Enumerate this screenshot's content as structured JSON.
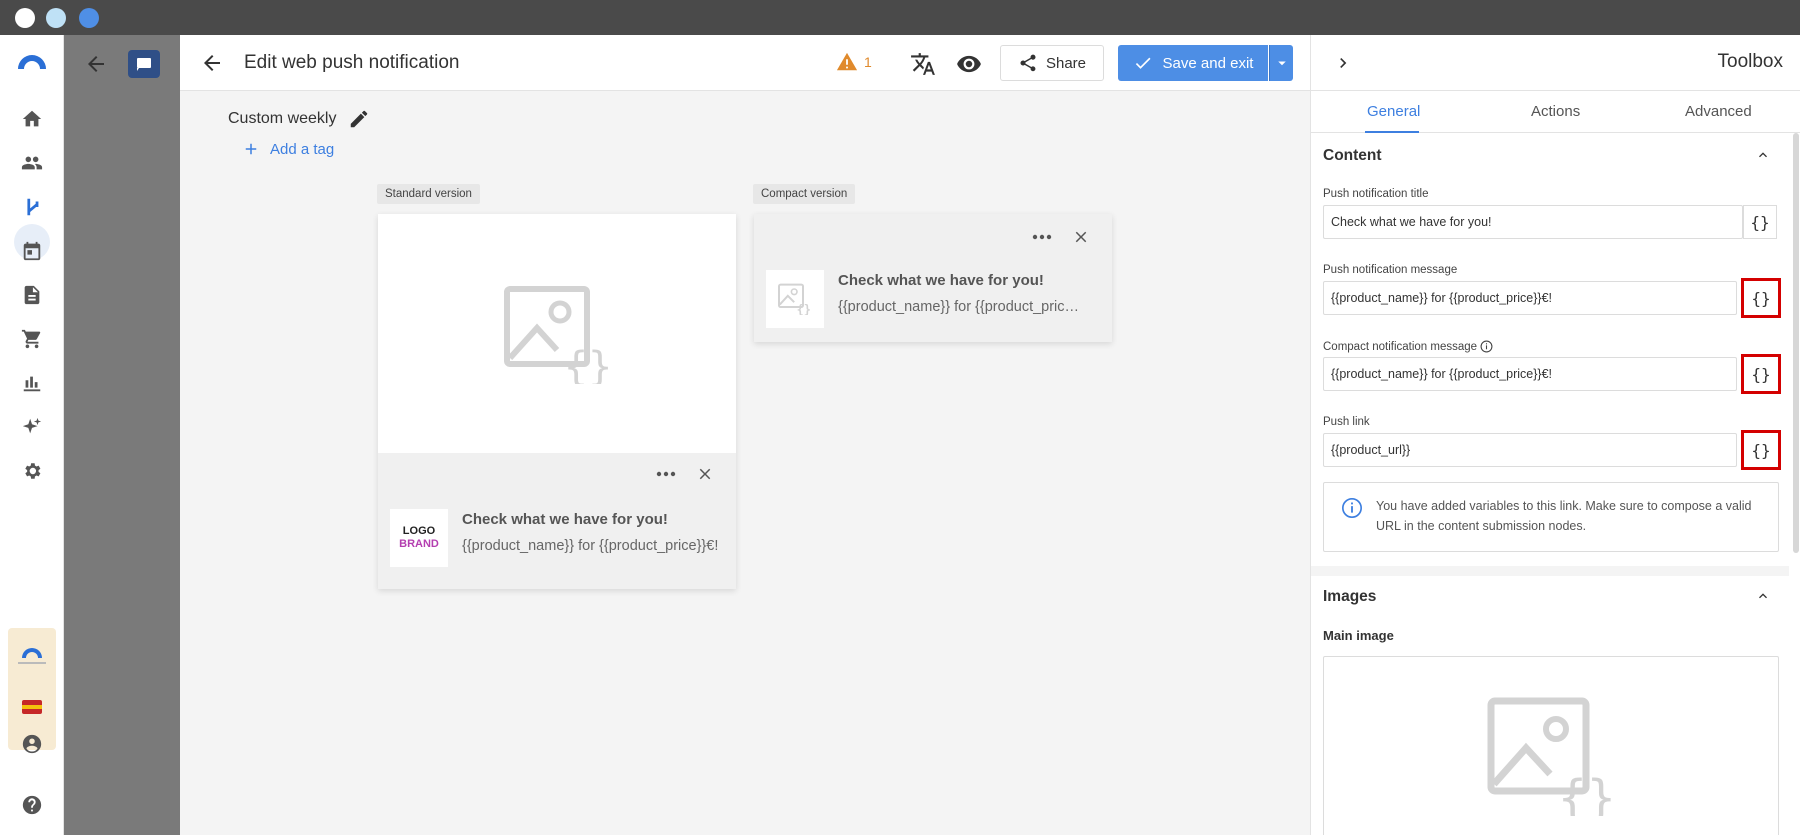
{
  "window": {
    "dots": [
      "#ffffff",
      "#bfe1f6",
      "#4f8fe6"
    ]
  },
  "header": {
    "title": "Edit web push notification",
    "warning_count": "1",
    "share_label": "Share",
    "save_label": "Save and exit"
  },
  "campaign": {
    "name": "Custom weekly",
    "add_tag_label": "Add a tag"
  },
  "standard_version": {
    "label": "Standard version",
    "logo_line1": "LOGO",
    "logo_line2": "BRAND",
    "title": "Check what we have for you!",
    "message": "{{product_name}} for {{product_price}}€!"
  },
  "compact_version": {
    "label": "Compact version",
    "title": "Check what we have for you!",
    "message": "{{product_name}} for {{product_pric…"
  },
  "toolbox": {
    "title": "Toolbox",
    "tabs": [
      "General",
      "Actions",
      "Advanced"
    ],
    "active_tab": "General",
    "content_section": {
      "title": "Content",
      "fields": [
        {
          "label": "Push notification title",
          "value": "Check what we have for you!"
        },
        {
          "label": "Push notification message",
          "value": "{{product_name}} for {{product_price}}€!"
        },
        {
          "label": "Compact notification message",
          "value": "{{product_name}} for {{product_price}}€!"
        },
        {
          "label": "Push link",
          "value": "{{product_url}}"
        }
      ],
      "variable_button_label": "{}",
      "info_message": "You have added variables to this link. Make sure to compose a valid URL in the content submission nodes."
    },
    "images_section": {
      "title": "Images",
      "main_image_label": "Main image"
    }
  },
  "colors": {
    "accent": "#3d7fe0",
    "primary_button": "#4d8ee5",
    "warning": "#e08a2c",
    "highlight_border": "#d40000"
  }
}
